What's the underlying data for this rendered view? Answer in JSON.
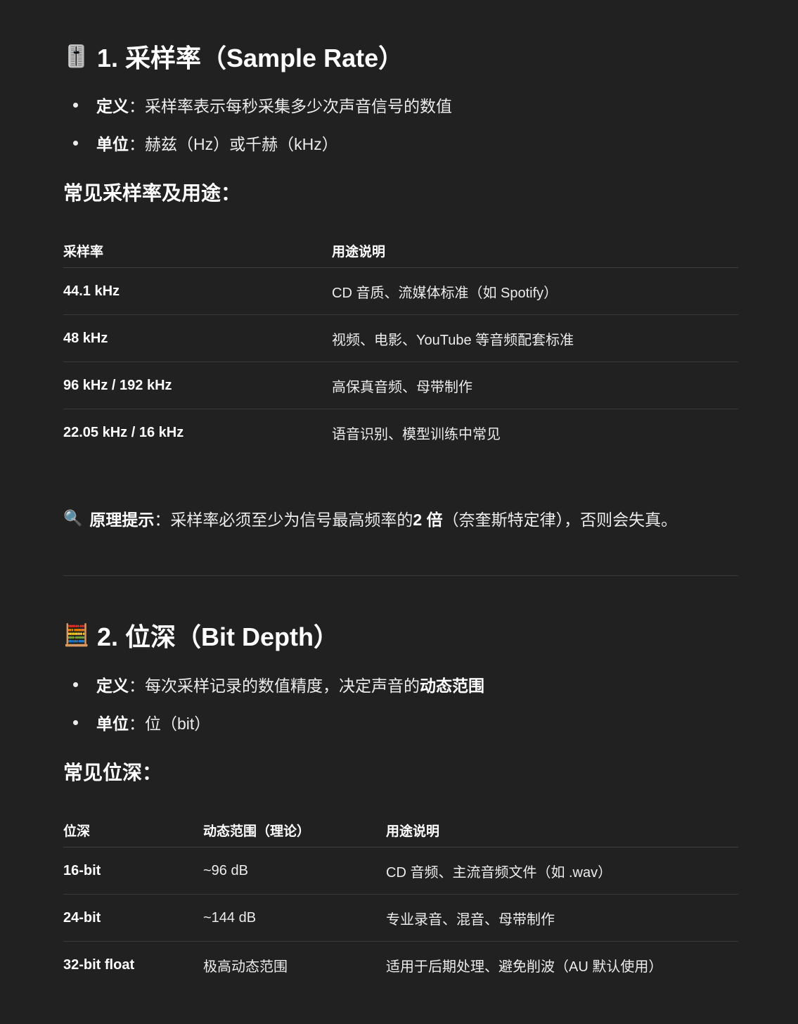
{
  "s1": {
    "icon": "🎚️",
    "title": "1. 采样率（Sample Rate）",
    "bullets": [
      {
        "label": "定义",
        "text": "：采样率表示每秒采集多少次声音信号的数值"
      },
      {
        "label": "单位",
        "text": "：赫兹（Hz）或千赫（kHz）"
      }
    ],
    "subheading": "常见采样率及用途：",
    "table": {
      "headers": [
        "采样率",
        "用途说明"
      ],
      "rows": [
        [
          "44.1 kHz",
          "CD 音质、流媒体标准（如 Spotify）"
        ],
        [
          "48 kHz",
          "视频、电影、YouTube 等音频配套标准"
        ],
        [
          "96 kHz / 192 kHz",
          "高保真音频、母带制作"
        ],
        [
          "22.05 kHz / 16 kHz",
          "语音识别、模型训练中常见"
        ]
      ]
    },
    "tip": {
      "icon": "🔍",
      "label": "原理提示",
      "pre": "：采样率必须至少为信号最高频率的 ",
      "bold": "2 倍",
      "post": "（奈奎斯特定律），否则会失真。"
    }
  },
  "s2": {
    "icon": "🧮",
    "title": "2. 位深（Bit Depth）",
    "bullets": [
      {
        "label": "定义",
        "text": "：每次采样记录的数值精度，决定声音的",
        "bold": "动态范围"
      },
      {
        "label": "单位",
        "text": "：位（bit）"
      }
    ],
    "subheading": "常见位深：",
    "table": {
      "headers": [
        "位深",
        "动态范围（理论）",
        "用途说明"
      ],
      "rows": [
        [
          "16-bit",
          "~96 dB",
          "CD 音频、主流音频文件（如 .wav）"
        ],
        [
          "24-bit",
          "~144 dB",
          "专业录音、混音、母带制作"
        ],
        [
          "32-bit float",
          "极高动态范围",
          "适用于后期处理、避免削波（AU 默认使用）"
        ]
      ]
    }
  }
}
